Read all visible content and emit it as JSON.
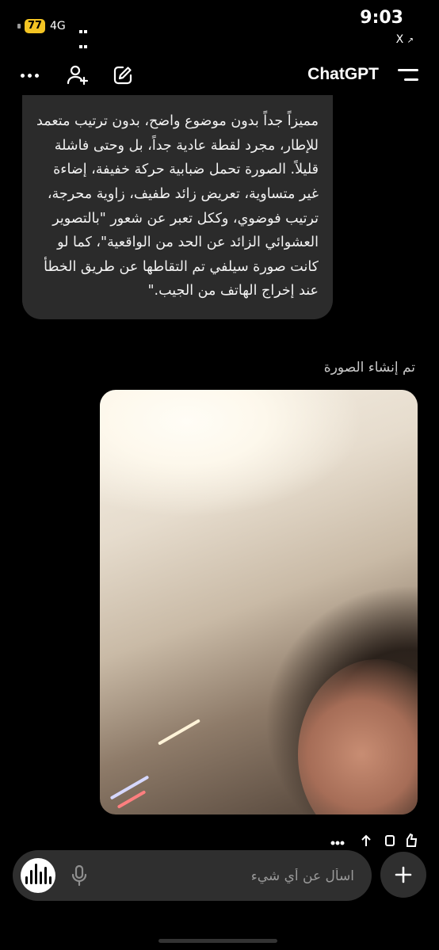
{
  "status_bar": {
    "battery": "77",
    "network": "4G",
    "time": "9:03",
    "back_app": "X"
  },
  "header": {
    "title": "ChatGPT",
    "icons": [
      "more-icon",
      "add-user-icon",
      "edit-icon",
      "menu-icon"
    ]
  },
  "chat": {
    "assistant_message": "مميزاً جداً بدون موضوع واضح، بدون ترتيب متعمد للإطار، مجرد لقطة عادية جداً، بل وحتى فاشلة قليلاً. الصورة تحمل ضبابية حركة خفيفة، إضاءة غير متساوية، تعريض زائد طفيف، زاوية محرجة، ترتيب فوضوي، وككل تعبر عن شعور \"بالتصوير العشوائي الزائد عن الحد من الواقعية\"، كما لو كانت صورة سيلفي تم التقاطها عن طريق الخطأ عند إخراج الهاتف من الجيب.\"",
    "generated_label": "تم إنشاء الصورة",
    "image_alt": "Blurry accidental selfie",
    "action_icons": [
      "more-icon",
      "share-icon",
      "copy-icon",
      "like-icon"
    ]
  },
  "composer": {
    "placeholder": "اسأل عن أي شيء",
    "value": ""
  },
  "colors": {
    "background": "#000000",
    "bubble": "#2b2b2b",
    "composer": "#2f2f2f",
    "battery": "#f3c423"
  }
}
